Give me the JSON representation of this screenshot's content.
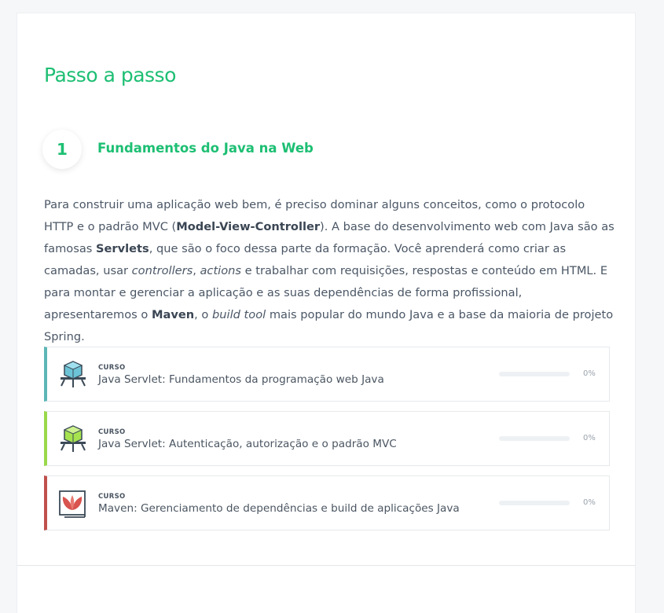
{
  "section": {
    "title": "Passo a passo"
  },
  "step": {
    "number": "1",
    "title": "Fundamentos do Java na Web",
    "description": {
      "p1": "Para construir uma aplicação web bem, é preciso dominar alguns conceitos, como o protocolo HTTP e o padrão MVC (",
      "b1": "Model-View-Controller",
      "p2": "). A base do desenvolvimento web com Java são as famosas ",
      "b2": "Servlets",
      "p3": ", que são o foco dessa parte da formação. Você aprenderá como criar as camadas, usar ",
      "i1": "controllers",
      "p4": ", ",
      "i2": "actions",
      "p5": " e trabalhar com requisições, respostas e conteúdo em HTML. E para montar e gerenciar a aplicação e as suas dependências de forma profissional, apresentaremos o ",
      "b3": "Maven",
      "p6": ", o ",
      "i3": "build tool",
      "p7": " mais popular do mundo Java e a base da maioria de projeto Spring."
    }
  },
  "courses": [
    {
      "kind": "CURSO",
      "name": "Java Servlet: Fundamentos da programação web Java",
      "progress": 0,
      "progress_label": "0%",
      "accent": "#5db6b6",
      "icon": "servlet-cube-blue-icon"
    },
    {
      "kind": "CURSO",
      "name": "Java Servlet: Autenticação, autorização e o padrão MVC",
      "progress": 0,
      "progress_label": "0%",
      "accent": "#9ad94a",
      "icon": "servlet-cube-green-icon"
    },
    {
      "kind": "CURSO",
      "name": "Maven: Gerenciamento de dependências e build de aplicações Java",
      "progress": 0,
      "progress_label": "0%",
      "accent": "#c0504d",
      "icon": "maven-feather-icon"
    }
  ],
  "colors": {
    "brand": "#1dbf73",
    "text": "#4a5561"
  }
}
